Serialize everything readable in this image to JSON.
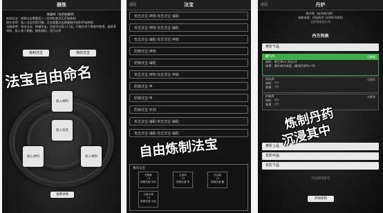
{
  "panel1": {
    "title": "器炼",
    "info_lines": [
      "炼器师（玄阶练器师）",
      "炼制法宝：炼制法宝需要投入一定材料和灵石开始炼制",
      "操作说明：投入法宝后再打磨，点击我要点击就能制作材料开始炼制",
      "法器说明：攻击法宝、防御法宝，全部可以投入门派。只能在合于黄境中使用。越多多材料，投入多少都能，越多越好，也可以多"
    ],
    "btn_craft": "炼制法宝",
    "btn_name": "我的法宝",
    "slot_top": "投入材料",
    "slot_center": "投入法宝",
    "slot_left": "投入材料",
    "slot_right": "投入材料",
    "btn_detail": "查看详情",
    "caption": "法宝自由命名"
  },
  "panel2": {
    "back": "返回",
    "title": "法宝",
    "rows": [
      "攻击法宝·神物·攻击法宝·辅助",
      "攻击法宝·神物·攻击法宝·辅助",
      "攻击法宝·辅助·攻击法宝·神物",
      "防御法宝·神物",
      "防御法宝·辅助",
      "攻击法宝·神物·攻击法宝·神物",
      "防御法宝·甲",
      "防御法宝·甲",
      "防御法宝·天剑",
      "攻击法宝·辅助·攻击法宝·辅助",
      "攻击法宝·辅助·攻击法宝·辅助"
    ],
    "section_title": "我的法宝",
    "cells": [
      [
        "无相珠",
        "+0",
        "防御法宝·天剑"
      ],
      [
        "云雀衣",
        "+0",
        "防御法宝·甲"
      ],
      [
        "白云扇",
        "+0",
        "防御法宝·鳌"
      ],
      [
        "云雀大将",
        "+0",
        "防御法宝·天剑"
      ]
    ],
    "caption": "自由炼制法宝"
  },
  "panel3": {
    "back": "返回",
    "title": "丹炉",
    "info": [
      "炼丹师（金丹练丹师）",
      "修炼进度：初始练丹 (1000/1000)",
      "当前等级练丹术"
    ],
    "list_title": "丹方列表",
    "items": [
      {
        "name": "黄阶下品",
        "selected": false
      },
      {
        "name": "聚气丹",
        "selected": true,
        "tag": "已解锁",
        "desc": [
          "材料：青兰草x1 灵石x3",
          "效果：提升修为进度，服用后修为+20"
        ]
      },
      {
        "name": "培元丹",
        "selected": false,
        "tag": "未解锁",
        "desc": [
          "材料：???",
          "效果：???"
        ]
      },
      {
        "name": "护体丹",
        "selected": false,
        "tag": "未解锁",
        "desc": [
          "材料：???",
          "效果：???"
        ]
      }
    ],
    "bars": [
      "黄阶上品",
      "玄阶中品",
      "玄阶下品"
    ],
    "btn_open": "开始炼制",
    "status_text": "点击制作即可",
    "caption_line1": "炼制丹药",
    "caption_line2": "沉浸其中"
  },
  "colors": {
    "accent_green": "#3fae49",
    "panel_bg": "#141414"
  }
}
